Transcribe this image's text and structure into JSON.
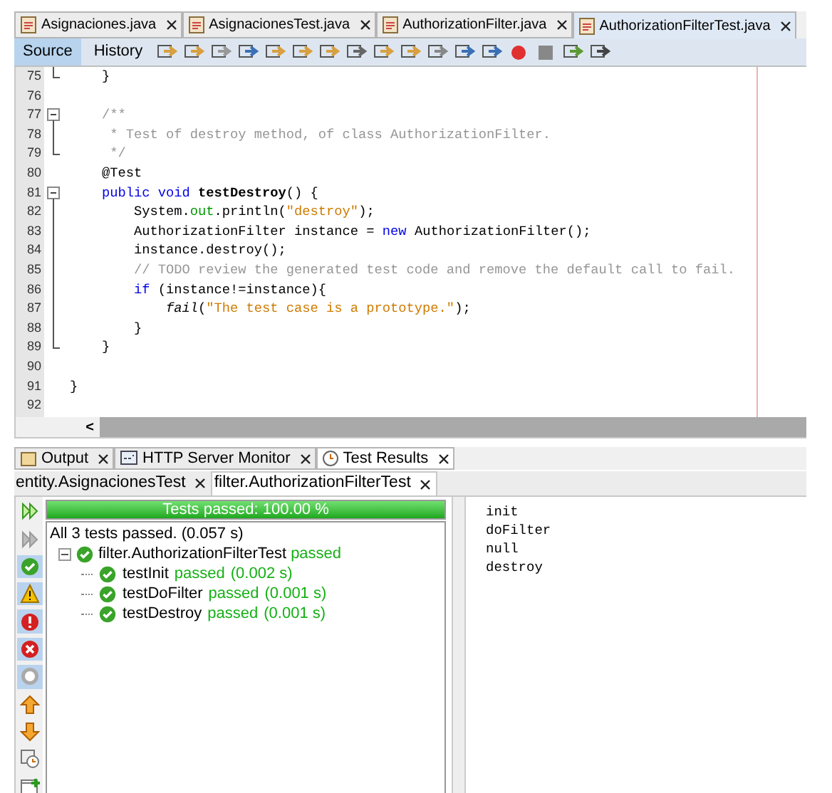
{
  "editor_tabs": [
    {
      "label": "Asignaciones.java",
      "selected": false
    },
    {
      "label": "AsignacionesTest.java",
      "selected": false
    },
    {
      "label": "AuthorizationFilter.java",
      "selected": false
    },
    {
      "label": "AuthorizationFilterTest.java",
      "selected": true
    }
  ],
  "editor_toolbar": {
    "views": [
      {
        "label": "Source",
        "selected": true
      },
      {
        "label": "History",
        "selected": false
      }
    ]
  },
  "code_lines": [
    {
      "number": "75",
      "kind": "end",
      "tokens": [
        {
          "kind": "plain",
          "text": "    }"
        }
      ]
    },
    {
      "number": "76",
      "kind": "none"
    },
    {
      "number": "77",
      "kind": "start",
      "tokens": [
        {
          "kind": "comment",
          "text": "    /**"
        }
      ]
    },
    {
      "number": "78",
      "kind": "line",
      "tokens": [
        {
          "kind": "comment",
          "text": "     * Test of destroy method, of class AuthorizationFilter."
        }
      ]
    },
    {
      "number": "79",
      "kind": "end",
      "tokens": [
        {
          "kind": "comment",
          "text": "     */"
        }
      ]
    },
    {
      "number": "80",
      "kind": "none",
      "tokens": [
        {
          "kind": "plain",
          "text": "    @Test"
        }
      ]
    },
    {
      "number": "81",
      "kind": "start",
      "tokens": [
        {
          "kind": "keyword",
          "text": "    public void "
        },
        {
          "kind": "bold",
          "text": "testDestroy"
        },
        {
          "kind": "plain",
          "text": "() {"
        }
      ]
    },
    {
      "number": "82",
      "kind": "line",
      "tokens": [
        {
          "kind": "plain",
          "text": "        System."
        },
        {
          "kind": "field",
          "text": "out"
        },
        {
          "kind": "plain",
          "text": ".println("
        },
        {
          "kind": "string",
          "text": "\"destroy\""
        },
        {
          "kind": "plain",
          "text": ");"
        }
      ]
    },
    {
      "number": "83",
      "kind": "line",
      "tokens": [
        {
          "kind": "plain",
          "text": "        AuthorizationFilter instance = "
        },
        {
          "kind": "keyword",
          "text": "new"
        },
        {
          "kind": "plain",
          "text": " AuthorizationFilter();"
        }
      ]
    },
    {
      "number": "84",
      "kind": "line",
      "tokens": [
        {
          "kind": "plain",
          "text": "        instance.destroy();"
        }
      ]
    },
    {
      "number": "85",
      "kind": "line",
      "tokens": [
        {
          "kind": "comment",
          "text": "        // TODO review the generated test code and remove the default call to fail."
        }
      ]
    },
    {
      "number": "86",
      "kind": "line",
      "tokens": [
        {
          "kind": "keyword",
          "text": "        if"
        },
        {
          "kind": "plain",
          "text": " (instance!=instance){"
        }
      ]
    },
    {
      "number": "87",
      "kind": "line",
      "tokens": [
        {
          "kind": "italic",
          "text": "            fail"
        },
        {
          "kind": "plain",
          "text": "("
        },
        {
          "kind": "string",
          "text": "\"The test case is a prototype.\""
        },
        {
          "kind": "plain",
          "text": ");"
        }
      ]
    },
    {
      "number": "88",
      "kind": "line",
      "tokens": [
        {
          "kind": "plain",
          "text": "        }"
        }
      ]
    },
    {
      "number": "89",
      "kind": "end",
      "tokens": [
        {
          "kind": "plain",
          "text": "    }"
        }
      ]
    },
    {
      "number": "90",
      "kind": "none"
    },
    {
      "number": "91",
      "kind": "none",
      "tokens": [
        {
          "kind": "plain",
          "text": "}"
        }
      ]
    },
    {
      "number": "92",
      "kind": "none"
    }
  ],
  "scroll_arrow": "<",
  "panel_tabs": [
    {
      "label": "Output",
      "kind": "output",
      "selected": false
    },
    {
      "label": "HTTP Server Monitor",
      "kind": "monitor",
      "selected": false
    },
    {
      "label": "Test Results",
      "kind": "tests",
      "selected": true
    }
  ],
  "result_tabs": [
    {
      "label": "entity.AsignacionesTest",
      "selected": false
    },
    {
      "label": "filter.AuthorizationFilterTest",
      "selected": true
    }
  ],
  "side_buttons": [
    {
      "kind": "rerun",
      "selected": false
    },
    {
      "kind": "rerun-failed",
      "selected": false
    },
    {
      "kind": "passed",
      "selected": true
    },
    {
      "kind": "warning",
      "selected": true
    },
    {
      "kind": "error",
      "selected": true
    },
    {
      "kind": "failed",
      "selected": true
    },
    {
      "kind": "skipped",
      "selected": true
    },
    {
      "kind": "up",
      "selected": false
    },
    {
      "kind": "down",
      "selected": false
    },
    {
      "kind": "history",
      "selected": false
    },
    {
      "kind": "new",
      "selected": false
    }
  ],
  "progress": {
    "label": "Tests passed: 100.00 %",
    "level": 1.0
  },
  "summary": "All 3 tests passed. (0.057 s)",
  "tree": {
    "name": "filter.AuthorizationFilterTest",
    "status": "passed",
    "expanded": true,
    "children": [
      {
        "name": "testInit",
        "status": "passed",
        "time": "(0.002 s)"
      },
      {
        "name": "testDoFilter",
        "status": "passed",
        "time": "(0.001 s)"
      },
      {
        "name": "testDestroy",
        "status": "passed",
        "time": "(0.001 s)"
      }
    ]
  },
  "output_lines": [
    "init",
    "doFilter",
    "null",
    "destroy"
  ]
}
